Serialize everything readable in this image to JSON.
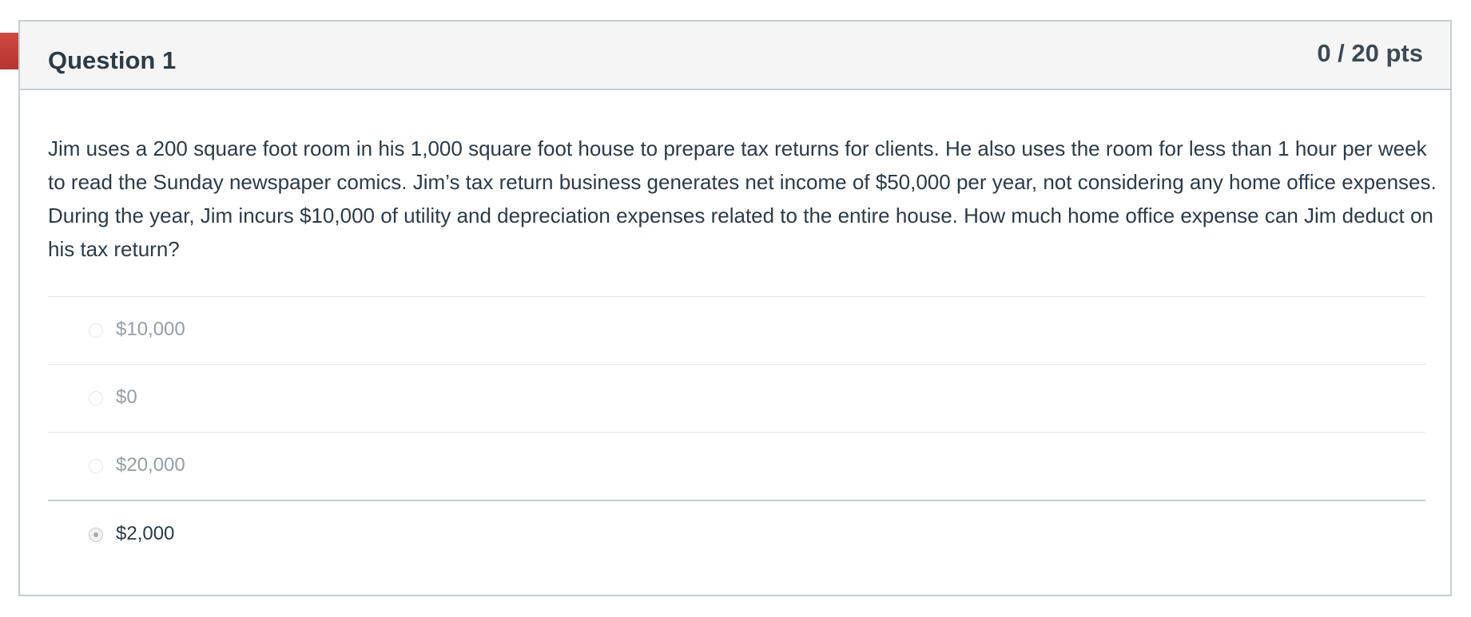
{
  "question": {
    "title": "Question 1",
    "points": "0 / 20 pts",
    "text": "Jim uses a 200 square foot room in his 1,000 square foot house to prepare tax returns for clients.  He also uses the room for less than 1 hour per week to read the Sunday newspaper comics.  Jim’s tax return business generates net income of $50,000 per year, not considering any home office expenses.  During the year, Jim incurs $10,000 of utility and depreciation expenses related to the entire house.  How much home office expense can Jim deduct on his tax return?",
    "flag_icon": "incorrect-flag-icon",
    "answers": [
      {
        "label": "$10,000",
        "selected": false
      },
      {
        "label": "$0",
        "selected": false
      },
      {
        "label": "$20,000",
        "selected": false
      },
      {
        "label": "$2,000",
        "selected": true
      }
    ]
  },
  "colors": {
    "flag": "#c2403a",
    "header_bg": "#f5f5f5",
    "border": "#c7cdd1",
    "text": "#2d3b45",
    "muted_answer": "#969ea4"
  }
}
